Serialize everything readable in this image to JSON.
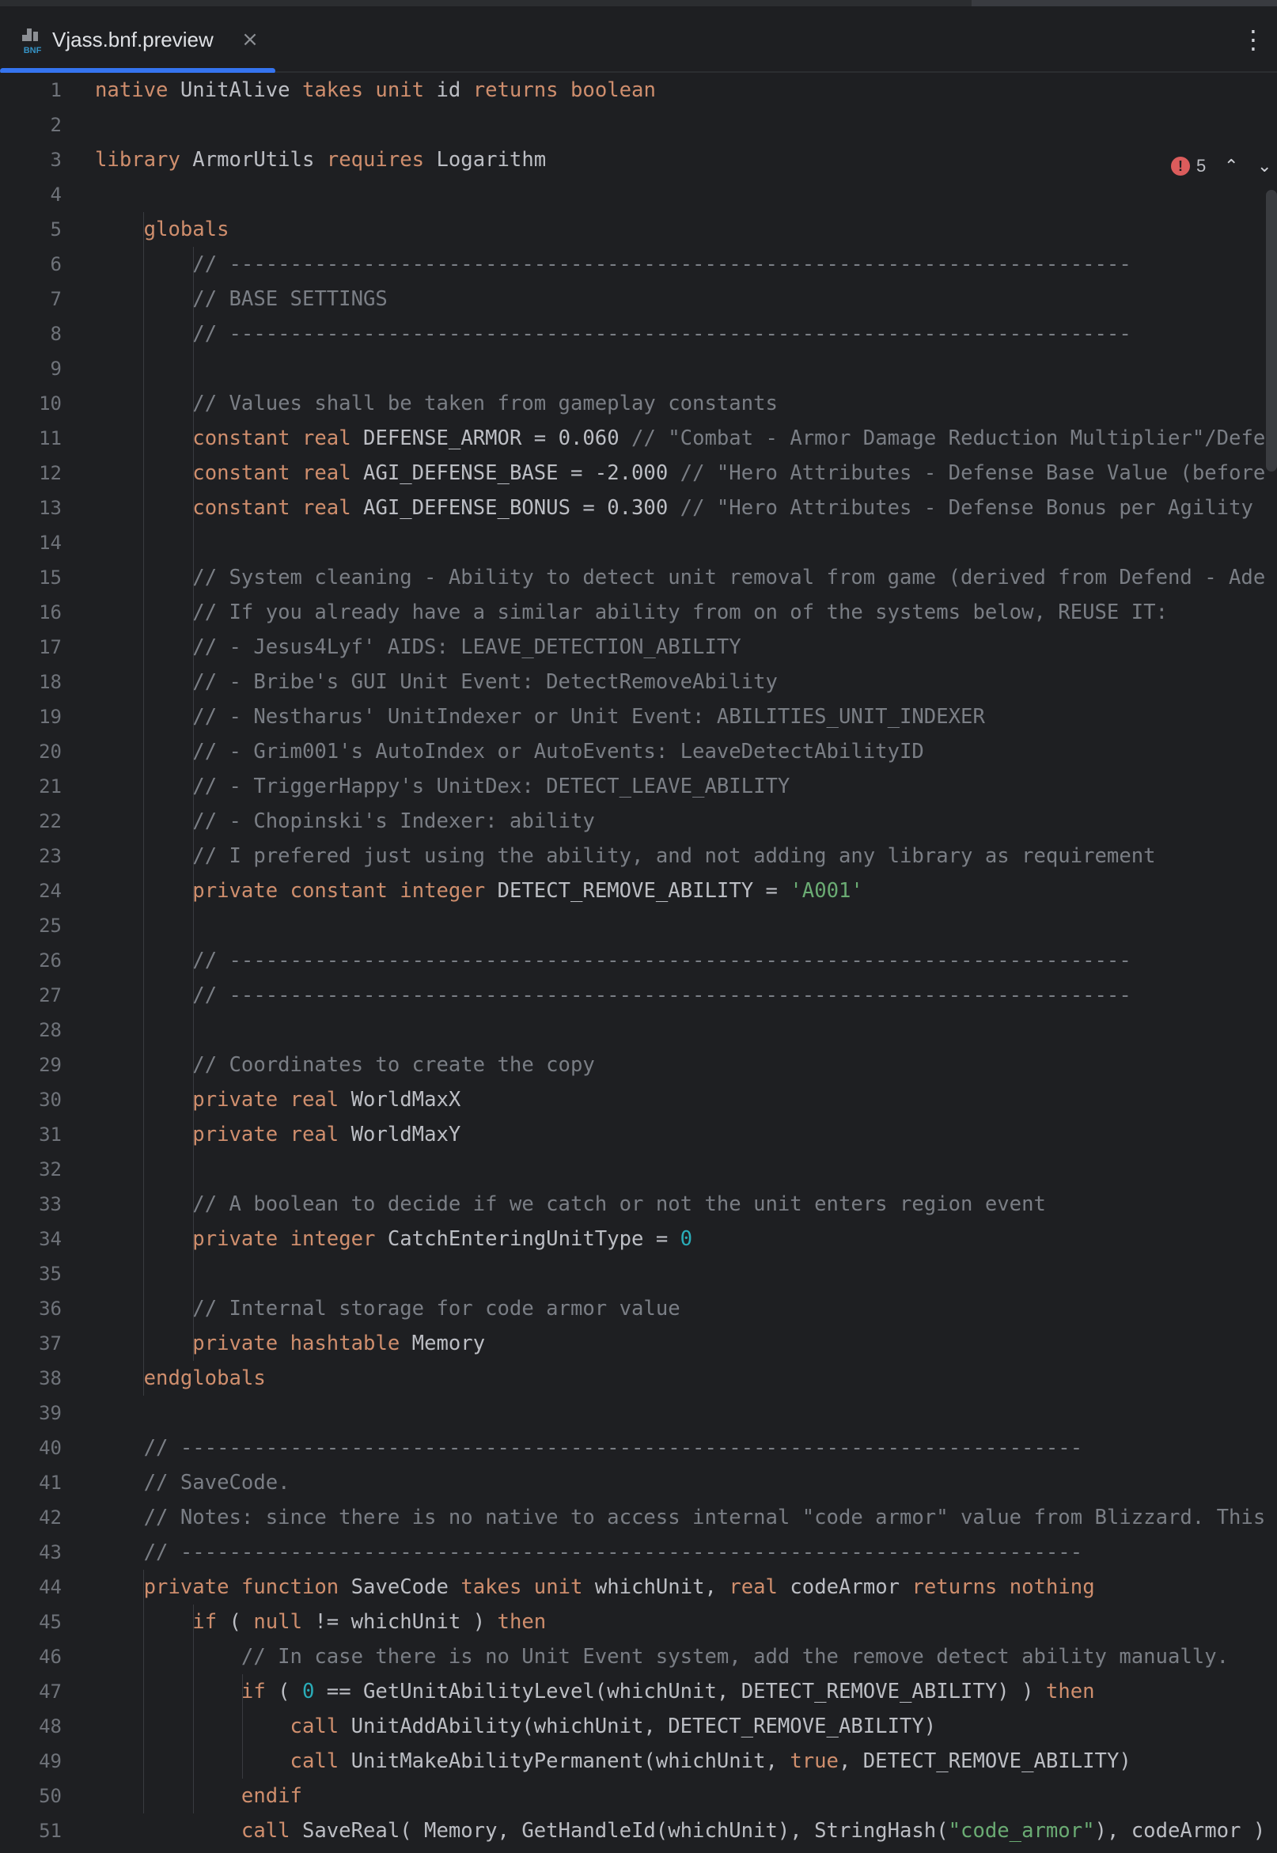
{
  "tab": {
    "icon_label": "BNF",
    "title": "Vjass.bnf.preview",
    "close_glyph": "×"
  },
  "toolbar": {
    "more_glyph": "⋮"
  },
  "inspections": {
    "error_count": "5",
    "up_glyph": "⌃",
    "down_glyph": "⌄"
  },
  "lines": [
    "native UnitAlive takes unit id returns boolean",
    "",
    "library ArmorUtils requires Logarithm",
    "",
    "    globals",
    "        // --------------------------------------------------------------------------",
    "        // BASE SETTINGS",
    "        // --------------------------------------------------------------------------",
    "",
    "        // Values shall be taken from gameplay constants",
    "        constant real DEFENSE_ARMOR = 0.060 // \"Combat - Armor Damage Reduction Multiplier\"/Defe",
    "        constant real AGI_DEFENSE_BASE = -2.000 // \"Hero Attributes - Defense Base Value (before",
    "        constant real AGI_DEFENSE_BONUS = 0.300 // \"Hero Attributes - Defense Bonus per Agility ",
    "",
    "        // System cleaning - Ability to detect unit removal from game (derived from Defend - Ade",
    "        // If you already have a similar ability from on of the systems below, REUSE IT:",
    "        // - Jesus4Lyf' AIDS: LEAVE_DETECTION_ABILITY",
    "        // - Bribe's GUI Unit Event: DetectRemoveAbility",
    "        // - Nestharus' UnitIndexer or Unit Event: ABILITIES_UNIT_INDEXER",
    "        // - Grim001's AutoIndex or AutoEvents: LeaveDetectAbilityID",
    "        // - TriggerHappy's UnitDex: DETECT_LEAVE_ABILITY",
    "        // - Chopinski's Indexer: ability",
    "        // I prefered just using the ability, and not adding any library as requirement",
    "        private constant integer DETECT_REMOVE_ABILITY = 'A001'",
    "",
    "        // --------------------------------------------------------------------------",
    "        // --------------------------------------------------------------------------",
    "",
    "        // Coordinates to create the copy",
    "        private real WorldMaxX",
    "        private real WorldMaxY",
    "",
    "        // A boolean to decide if we catch or not the unit enters region event",
    "        private integer CatchEnteringUnitType = 0",
    "",
    "        // Internal storage for code armor value",
    "        private hashtable Memory",
    "    endglobals",
    "",
    "    // --------------------------------------------------------------------------",
    "    // SaveCode.",
    "    // Notes: since there is no native to access internal \"code armor\" value from Blizzard. This",
    "    // --------------------------------------------------------------------------",
    "    private function SaveCode takes unit whichUnit, real codeArmor returns nothing",
    "        if ( null != whichUnit ) then",
    "            // In case there is no Unit Event system, add the remove detect ability manually.",
    "            if ( 0 == GetUnitAbilityLevel(whichUnit, DETECT_REMOVE_ABILITY) ) then",
    "                call UnitAddAbility(whichUnit, DETECT_REMOVE_ABILITY)",
    "                call UnitMakeAbilityPermanent(whichUnit, true, DETECT_REMOVE_ABILITY)",
    "            endif",
    "            call SaveReal( Memory, GetHandleId(whichUnit), StringHash(\"code_armor\"), codeArmor )"
  ]
}
